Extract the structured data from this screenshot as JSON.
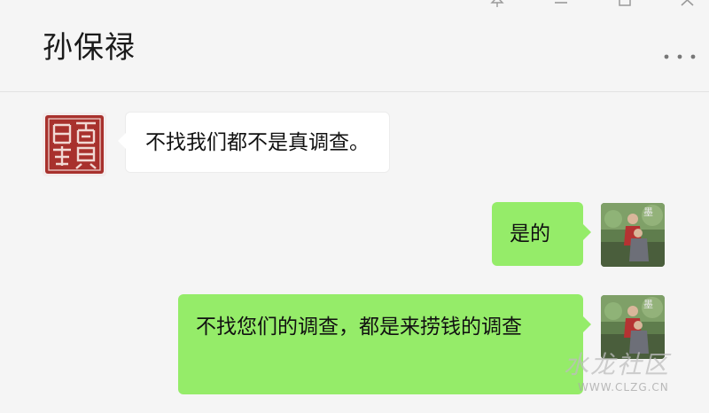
{
  "window": {
    "title": "孙保禄",
    "more_icon": "more-dots-icon",
    "controls": [
      "pin-icon",
      "minimize-icon",
      "maximize-icon",
      "close-icon"
    ]
  },
  "messages": [
    {
      "direction": "incoming",
      "text": "不找我们都不是真调查。"
    },
    {
      "direction": "outgoing",
      "text": "是的"
    },
    {
      "direction": "outgoing",
      "text": "不找您们的调查，都是来捞钱的调查"
    }
  ],
  "colors": {
    "outgoing_bubble": "#95ec69",
    "incoming_bubble": "#ffffff",
    "background": "#f5f5f5"
  },
  "watermark": {
    "text": "水龙社区",
    "url": "WWW.CLZG.CN"
  }
}
